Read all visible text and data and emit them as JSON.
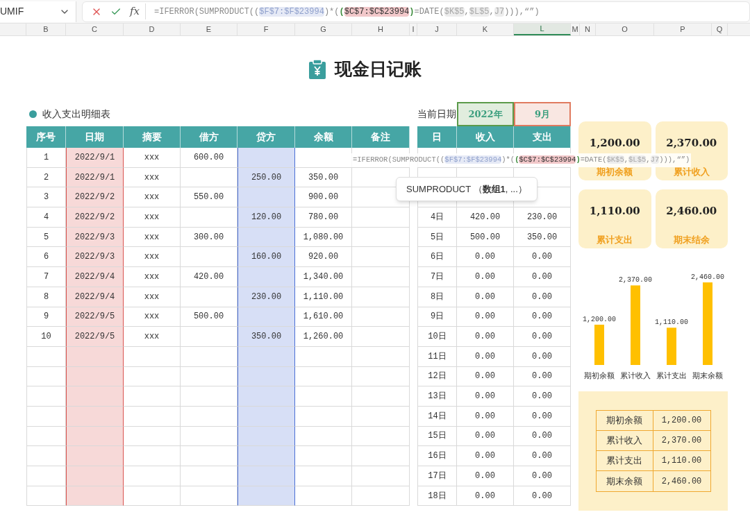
{
  "formula_bar": {
    "name_box": "UMIF",
    "fx_label": "fx",
    "formula": [
      {
        "kind": "plain",
        "text": "=IFERROR(SUMPRODUCT(("
      },
      {
        "kind": "ref_blue",
        "text": "$F$7:$F$23994"
      },
      {
        "kind": "plain",
        "text": ")*("
      },
      {
        "kind": "paren",
        "text": "("
      },
      {
        "kind": "ref_red",
        "text": "$C$7:$C$23994"
      },
      {
        "kind": "paren",
        "text": ")"
      },
      {
        "kind": "plain",
        "text": "=DATE("
      },
      {
        "kind": "ref_gray",
        "text": "$K$5"
      },
      {
        "kind": "plain",
        "text": ","
      },
      {
        "kind": "ref_gray",
        "text": "$L$5"
      },
      {
        "kind": "plain",
        "text": ","
      },
      {
        "kind": "ref_gray",
        "text": "J7"
      },
      {
        "kind": "plain",
        "text": "))),“”)"
      }
    ]
  },
  "column_headers": [
    {
      "label": "B",
      "selected": false
    },
    {
      "label": "C",
      "selected": false
    },
    {
      "label": "D",
      "selected": false
    },
    {
      "label": "E",
      "selected": false
    },
    {
      "label": "F",
      "selected": false
    },
    {
      "label": "G",
      "selected": false
    },
    {
      "label": "H",
      "selected": false
    },
    {
      "label": "I",
      "selected": false
    },
    {
      "label": "J",
      "selected": false
    },
    {
      "label": "K",
      "selected": false
    },
    {
      "label": "L",
      "selected": true
    },
    {
      "label": "M",
      "selected": false
    },
    {
      "label": "N",
      "selected": false
    },
    {
      "label": "O",
      "selected": false
    },
    {
      "label": "P",
      "selected": false
    },
    {
      "label": "Q",
      "selected": false
    }
  ],
  "title": "现金日记账",
  "ledger": {
    "title": "收入支出明细表",
    "columns": [
      {
        "label": "序号"
      },
      {
        "label": "日期",
        "color": "#d9534f"
      },
      {
        "label": "摘要"
      },
      {
        "label": "借方"
      },
      {
        "label": "贷方",
        "color": "#4a6fd6"
      },
      {
        "label": "余额"
      },
      {
        "label": "备注"
      }
    ],
    "rows": [
      {
        "no": "1",
        "date": "2022/9/1",
        "summary": "xxx",
        "debit": "600.00"
      },
      {
        "no": "2",
        "date": "2022/9/1",
        "summary": "xxx",
        "credit": "250.00",
        "balance": "350.00"
      },
      {
        "no": "3",
        "date": "2022/9/2",
        "summary": "xxx",
        "debit": "550.00",
        "balance": "900.00"
      },
      {
        "no": "4",
        "date": "2022/9/2",
        "summary": "xxx",
        "credit": "120.00",
        "balance": "780.00"
      },
      {
        "no": "5",
        "date": "2022/9/3",
        "summary": "xxx",
        "debit": "300.00",
        "balance": "1,080.00"
      },
      {
        "no": "6",
        "date": "2022/9/3",
        "summary": "xxx",
        "credit": "160.00",
        "balance": "920.00"
      },
      {
        "no": "7",
        "date": "2022/9/4",
        "summary": "xxx",
        "debit": "420.00",
        "balance": "1,340.00"
      },
      {
        "no": "8",
        "date": "2022/9/4",
        "summary": "xxx",
        "credit": "230.00",
        "balance": "1,110.00"
      },
      {
        "no": "9",
        "date": "2022/9/5",
        "summary": "xxx",
        "debit": "500.00",
        "balance": "1,610.00"
      },
      {
        "no": "10",
        "date": "2022/9/5",
        "summary": "xxx",
        "credit": "350.00",
        "balance": "1,260.00"
      }
    ]
  },
  "daily": {
    "date_label": "当前日期",
    "date_fields": [
      {
        "value": "2022年",
        "color": "#5b9a4a"
      },
      {
        "value": "9月",
        "color": "#e07a5f"
      }
    ],
    "columns": [
      "日",
      "收入",
      "支出"
    ],
    "rows": [
      {},
      {},
      {},
      {
        "day": "4日",
        "income": "420.00",
        "expense": "230.00"
      },
      {
        "day": "5日",
        "income": "500.00",
        "expense": "350.00"
      },
      {
        "day": "6日",
        "income": "0.00",
        "expense": "0.00"
      },
      {
        "day": "7日",
        "income": "0.00",
        "expense": "0.00"
      },
      {
        "day": "8日",
        "income": "0.00",
        "expense": "0.00"
      },
      {
        "day": "9日",
        "income": "0.00",
        "expense": "0.00"
      },
      {
        "day": "10日",
        "income": "0.00",
        "expense": "0.00"
      },
      {
        "day": "11日",
        "income": "0.00",
        "expense": "0.00"
      },
      {
        "day": "12日",
        "income": "0.00",
        "expense": "0.00"
      },
      {
        "day": "13日",
        "income": "0.00",
        "expense": "0.00"
      },
      {
        "day": "14日",
        "income": "0.00",
        "expense": "0.00"
      },
      {
        "day": "15日",
        "income": "0.00",
        "expense": "0.00"
      },
      {
        "day": "16日",
        "income": "0.00",
        "expense": "0.00"
      },
      {
        "day": "17日",
        "income": "0.00",
        "expense": "0.00"
      },
      {
        "day": "18日",
        "income": "0.00",
        "expense": "0.00"
      }
    ]
  },
  "cards": [
    {
      "value": "1,200.00",
      "label": "期初余额"
    },
    {
      "value": "2,370.00",
      "label": "累计收入"
    },
    {
      "value": "1,110.00",
      "label": "累计支出"
    },
    {
      "value": "2,460.00",
      "label": "期末结余"
    }
  ],
  "chart": {
    "chart_data": {
      "type": "bar",
      "categories": [
        "期初余额",
        "累计收入",
        "累计支出",
        "期末余额"
      ],
      "series": [
        {
          "color": "#ffc000",
          "values": [
            1200,
            2370,
            1110,
            2460
          ],
          "value_labels": [
            "1,200.00",
            "2,370.00",
            "1,110.00",
            "2,460.00"
          ]
        }
      ],
      "data_labels": true
    }
  },
  "summary": [
    {
      "label": "期初余额",
      "value": "1,200.00"
    },
    {
      "label": "累计收入",
      "value": "2,370.00"
    },
    {
      "label": "累计支出",
      "value": "1,110.00"
    },
    {
      "label": "期末余额",
      "value": "2,460.00"
    }
  ],
  "overlay_formula": [
    {
      "kind": "plain",
      "text": "=IFERROR(SUMPRODUCT(("
    },
    {
      "kind": "ref_blue",
      "text": "$F$7:$F$23994"
    },
    {
      "kind": "plain",
      "text": ")*("
    },
    {
      "kind": "paren",
      "text": "("
    },
    {
      "kind": "ref_red",
      "text": "$C$7:$C$23994"
    },
    {
      "kind": "paren",
      "text": ")"
    },
    {
      "kind": "plain",
      "text": "=DATE("
    },
    {
      "kind": "ref_gray",
      "text": "$K$5"
    },
    {
      "kind": "plain",
      "text": ","
    },
    {
      "kind": "ref_gray",
      "text": "$L$5"
    },
    {
      "kind": "plain",
      "text": ","
    },
    {
      "kind": "ref_gray",
      "text": "J7"
    },
    {
      "kind": "plain",
      "text": "))),“”)"
    }
  ],
  "tooltip": "SUMPRODUCT （**数组1**, ...）"
}
